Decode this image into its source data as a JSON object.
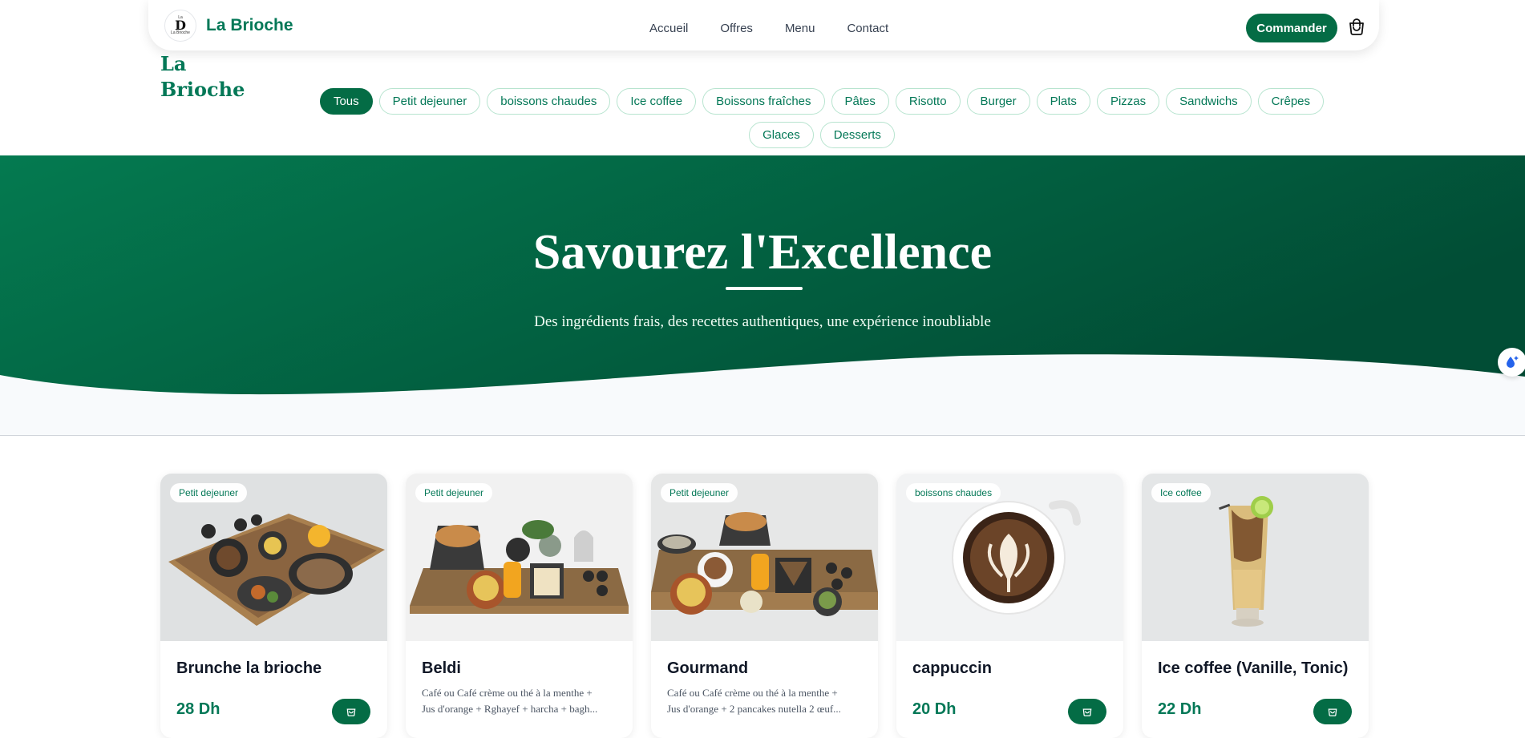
{
  "nav": {
    "brand": "La Brioche",
    "logo_letter": "D",
    "logo_small_top": "La",
    "logo_small_bottom": "La Brioche",
    "links": [
      "Accueil",
      "Offres",
      "Menu",
      "Contact"
    ],
    "order_label": "Commander"
  },
  "side_title": "La Brioche",
  "categories": [
    "Tous",
    "Petit dejeuner",
    "boissons chaudes",
    "Ice coffee",
    "Boissons fraîches",
    "Pâtes",
    "Risotto",
    "Burger",
    "Plats",
    "Pizzas",
    "Sandwichs",
    "Crêpes",
    "Glaces",
    "Desserts"
  ],
  "active_category": "Tous",
  "hero": {
    "title": "Savourez l'Excellence",
    "subtitle": "Des ingrédients frais, des recettes authentiques, une expérience inoubliable"
  },
  "products": [
    {
      "tag": "Petit dejeuner",
      "name": "Brunche la brioche",
      "price": "28 Dh",
      "desc1": "",
      "desc2": ""
    },
    {
      "tag": "Petit dejeuner",
      "name": "Beldi",
      "price": "",
      "desc1": "Café ou Café crème ou thé à la menthe +",
      "desc2": "Jus d'orange + Rghayef + harcha + bagh..."
    },
    {
      "tag": "Petit dejeuner",
      "name": "Gourmand",
      "price": "",
      "desc1": "Café ou Café crème ou thé à la menthe +",
      "desc2": "Jus d'orange + 2 pancakes nutella 2 œuf..."
    },
    {
      "tag": "boissons chaudes",
      "name": "cappuccin",
      "price": "20 Dh",
      "desc1": "",
      "desc2": ""
    },
    {
      "tag": "Ice coffee",
      "name": "Ice coffee (Vanille, Tonic)",
      "price": "22 Dh",
      "desc1": "",
      "desc2": ""
    }
  ],
  "colors": {
    "primary": "#046c45",
    "hero_start": "#047a50",
    "hero_end": "#014d35"
  }
}
